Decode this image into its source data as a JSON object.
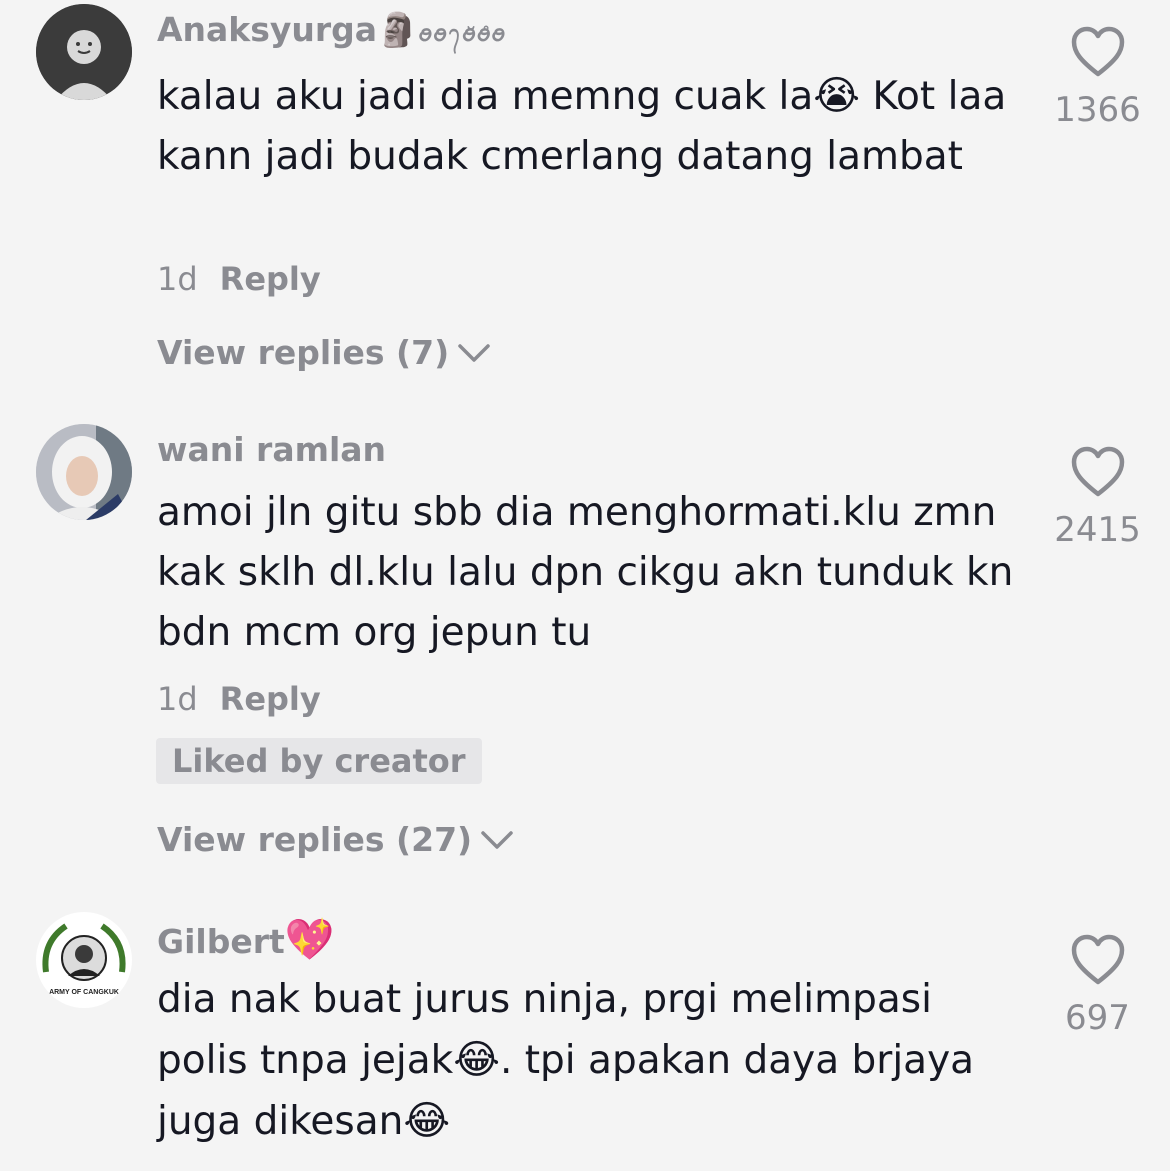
{
  "comments": [
    {
      "username": "Anaksyurga🗿",
      "username_suffix": "ꪮꪮ᭢ꪮ̆ꪮ̊ꪮ",
      "text_parts": [
        "kalau aku jadi dia memng cuak la",
        "😭",
        " Kot laa kann jadi budak cmerlang datang lambat"
      ],
      "time": "1d",
      "reply_label": "Reply",
      "likes": "1366",
      "view_replies": "View replies (7)"
    },
    {
      "username": "wani ramlan",
      "text_parts": [
        "amoi jln gitu sbb dia menghormati.klu zmn kak sklh dl.klu lalu dpn cikgu akn tunduk kn bdn mcm org jepun tu"
      ],
      "time": "1d",
      "reply_label": "Reply",
      "liked_by_creator": "Liked by creator",
      "likes": "2415",
      "view_replies": "View replies (27)"
    },
    {
      "username": "Gilbert",
      "username_emoji": "💖",
      "text_parts": [
        "dia nak buat jurus ninja, prgi melimpasi polis tnpa jejak",
        "😂",
        ". tpi apakan daya brjaya juga dikesan",
        "😂"
      ],
      "likes": "697",
      "avatar_badge_text": "ARMY OF CANGKUK"
    }
  ],
  "icons": {
    "like": "heart-outline-icon",
    "chevron": "chevron-down-icon"
  },
  "colors": {
    "background": "#f4f4f4",
    "secondary_text": "#8a8b91",
    "primary_text": "#161823"
  }
}
